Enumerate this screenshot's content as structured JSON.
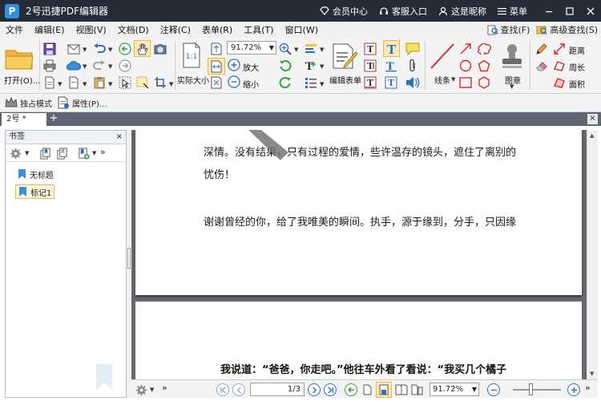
{
  "titlebar": {
    "logo_text": "P",
    "title": "2号迅捷PDF编辑器",
    "member_center": "会员中心",
    "customer_service": "客服入口",
    "nickname": "这是昵称",
    "menu": "菜单"
  },
  "menubar": {
    "items": [
      "文件",
      "编辑(E)",
      "视图(V)",
      "文档(D)",
      "注释(C)",
      "表单(R)",
      "工具(T)",
      "窗口(W)"
    ],
    "find": "查找(F)",
    "advanced_find": "高级查找(S)"
  },
  "ribbon": {
    "open_label": "打开(O)...",
    "actual_size_icon_text": "1:1",
    "actual_size_label": "实际大小",
    "zoom_value": "91.72%",
    "zoom_in_label": "放大",
    "zoom_out_label": "缩小",
    "edit_form_label": "编辑表单",
    "line_label": "线条",
    "stamp_label": "图章",
    "distance_label": "距离",
    "perimeter_label": "周长",
    "area_label": "面积"
  },
  "toolbar2": {
    "exclusive_mode": "独占模式",
    "properties": "属性(P)..."
  },
  "tabs": {
    "doc_tab": "2号 *",
    "add": "+",
    "close": "×"
  },
  "bookmark_panel": {
    "title": "书签",
    "close": "×",
    "items": [
      {
        "label": "无标题"
      },
      {
        "label": "标记1"
      }
    ]
  },
  "document": {
    "page1_lines": [
      "深情。没有结果，只有过程的爱情，些许温存的镜头，遮住了离别的",
      "忧伤！",
      "谢谢曾经的你，给了我唯美的瞬间。执手，源于缘到，分手，只因缘"
    ],
    "page2_line": "我说道：“爸爸，你走吧。”他往车外看了看说：“我买几个橘子"
  },
  "statusbar": {
    "page_value": "1",
    "page_total": "/3",
    "zoom_value": "91.72%"
  },
  "colors": {
    "titlebar_bg": "#242c3a",
    "accent_blue": "#2f8fe0",
    "tab_row_bg": "#5f6673",
    "viewer_bg": "#666a70",
    "bookmark_selected_border": "#f0b64a"
  }
}
